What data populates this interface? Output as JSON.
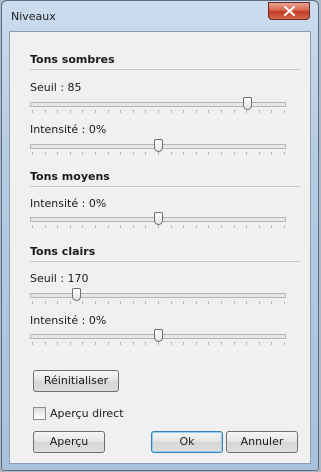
{
  "window": {
    "title": "Niveaux"
  },
  "sections": {
    "sombres": {
      "title": "Tons sombres",
      "seuil_label": "Seuil : 85",
      "seuil_fraction": 0.86,
      "intensite_label": "Intensité : 0%",
      "intensite_fraction": 0.5
    },
    "moyens": {
      "title": "Tons moyens",
      "intensite_label": "Intensité : 0%",
      "intensite_fraction": 0.5
    },
    "clairs": {
      "title": "Tons clairs",
      "seuil_label": "Seuil : 170",
      "seuil_fraction": 0.17,
      "intensite_label": "Intensité : 0%",
      "intensite_fraction": 0.5
    }
  },
  "buttons": {
    "reset": "Réinitialiser",
    "apercu": "Aperçu",
    "ok": "Ok",
    "annuler": "Annuler"
  },
  "checkbox": {
    "label": "Aperçu direct",
    "checked": false
  },
  "icons": {
    "close": "close-icon"
  },
  "colors": {
    "close_button": "#c03b22",
    "default_button_border": "#3c7fb1"
  }
}
